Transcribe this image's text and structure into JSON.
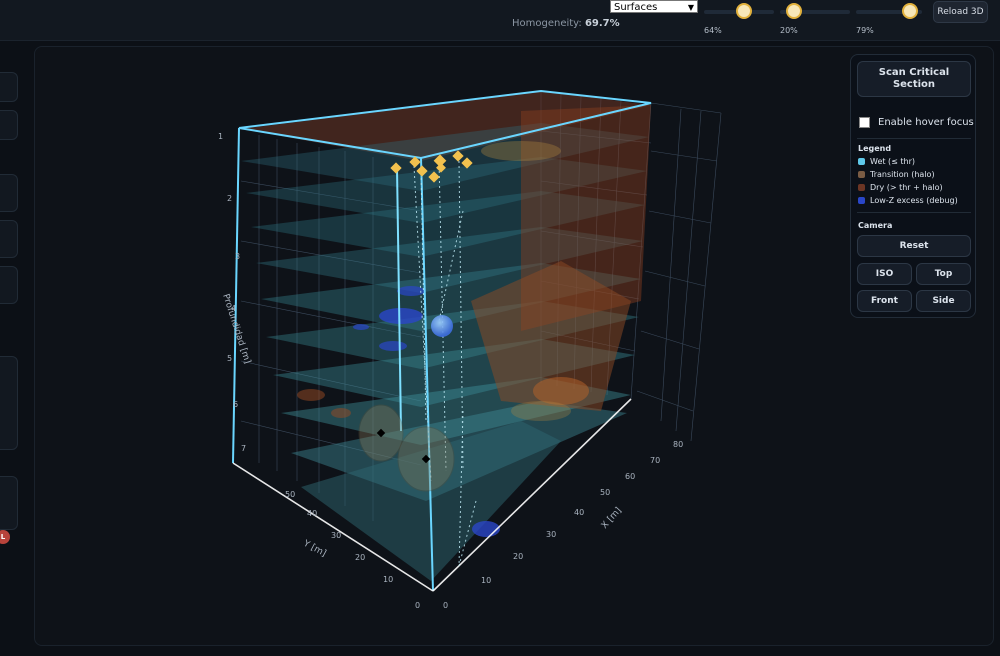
{
  "toolbar": {
    "homogeneity_label": "Homogeneity:",
    "homogeneity_value": "69.7%",
    "mode_select": "Surfaces",
    "sliders": [
      {
        "label": "64%",
        "value": 0.64
      },
      {
        "label": "20%",
        "value": 0.2
      },
      {
        "label": "79%",
        "value": 0.79
      }
    ],
    "reload_label": "Reload 3D"
  },
  "sidebar": {
    "badge_text": "L",
    "badge_color": "#b8433b"
  },
  "viewer": {
    "z_axis_label": "Profundidad [m]",
    "z_ticks": [
      "1",
      "2",
      "3",
      "4",
      "5",
      "6",
      "7"
    ],
    "y_axis_label": "Y [m]",
    "y_ticks": [
      "0",
      "10",
      "20",
      "30",
      "40",
      "50"
    ],
    "x_axis_label": "X [m]",
    "x_ticks": [
      "0",
      "10",
      "20",
      "30",
      "40",
      "50",
      "60",
      "70",
      "80"
    ]
  },
  "panel": {
    "scan_label": "Scan Critical Section",
    "hover_label": "Enable hover focus",
    "hover_enabled": false,
    "legend_title": "Legend",
    "legend": [
      {
        "label": "Wet (≤ thr)",
        "color": "#5fc9ea"
      },
      {
        "label": "Transition (halo)",
        "color": "#7a5c44"
      },
      {
        "label": "Dry (> thr + halo)",
        "color": "#6b3524"
      },
      {
        "label": "Low-Z excess (debug)",
        "color": "#2a46c8"
      }
    ],
    "camera_title": "Camera",
    "camera_buttons": {
      "reset": "Reset",
      "iso": "ISO",
      "top": "Top",
      "front": "Front",
      "side": "Side"
    }
  },
  "colors": {
    "accent_cyan": "#5fd0f2",
    "slider_thumb": "#f7e7b8",
    "marker_gold": "#f2c14e"
  }
}
